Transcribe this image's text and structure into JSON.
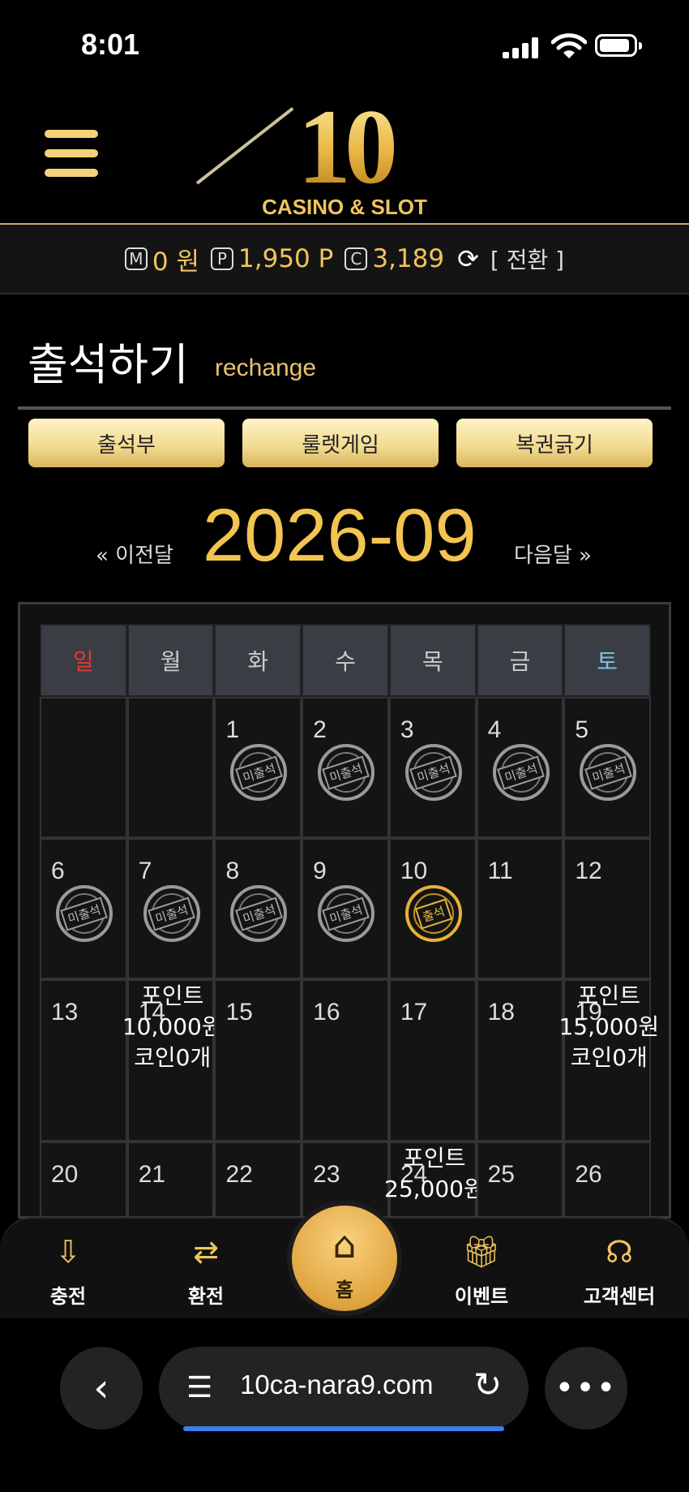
{
  "status_bar": {
    "time": "8:01"
  },
  "header": {
    "logo_number": "10",
    "logo_tagline": "CASINO & SLOT"
  },
  "balance": {
    "money_badge": "M",
    "money": "0 원",
    "point_badge": "P",
    "points": "1,950 P",
    "coin_badge": "C",
    "coins": "3,189",
    "convert_label": "[ 전환 ]"
  },
  "page": {
    "title": "출석하기",
    "subtitle": "rechange"
  },
  "tabs": [
    {
      "label": "출석부"
    },
    {
      "label": "룰렛게임"
    },
    {
      "label": "복권긁기"
    }
  ],
  "month_nav": {
    "prev": "« 이전달",
    "current": "2026-09",
    "next": "다음달 »"
  },
  "calendar": {
    "weekdays": [
      "일",
      "월",
      "화",
      "수",
      "목",
      "금",
      "토"
    ],
    "stamp_absent": "미출석",
    "stamp_present": "출석",
    "days": [
      "1",
      "2",
      "3",
      "4",
      "5",
      "6",
      "7",
      "8",
      "9",
      "10",
      "11",
      "12",
      "13",
      "14",
      "15",
      "16",
      "17",
      "18",
      "19",
      "20",
      "21",
      "22",
      "23",
      "24",
      "25",
      "26"
    ],
    "rewards": {
      "day14": "포인트 10,000원 코인0개",
      "day19": "포인트 15,000원 코인0개",
      "day24": "포인트 25,000원"
    }
  },
  "bottom_nav": {
    "charge": "충전",
    "exchange": "환전",
    "home": "홈",
    "event": "이벤트",
    "support": "고객센터"
  },
  "browser": {
    "url": "10ca-nara9.com"
  },
  "colors": {
    "gold": "#f2c451",
    "background": "#000000",
    "sunday": "#e53935",
    "saturday": "#7ec4e8"
  }
}
